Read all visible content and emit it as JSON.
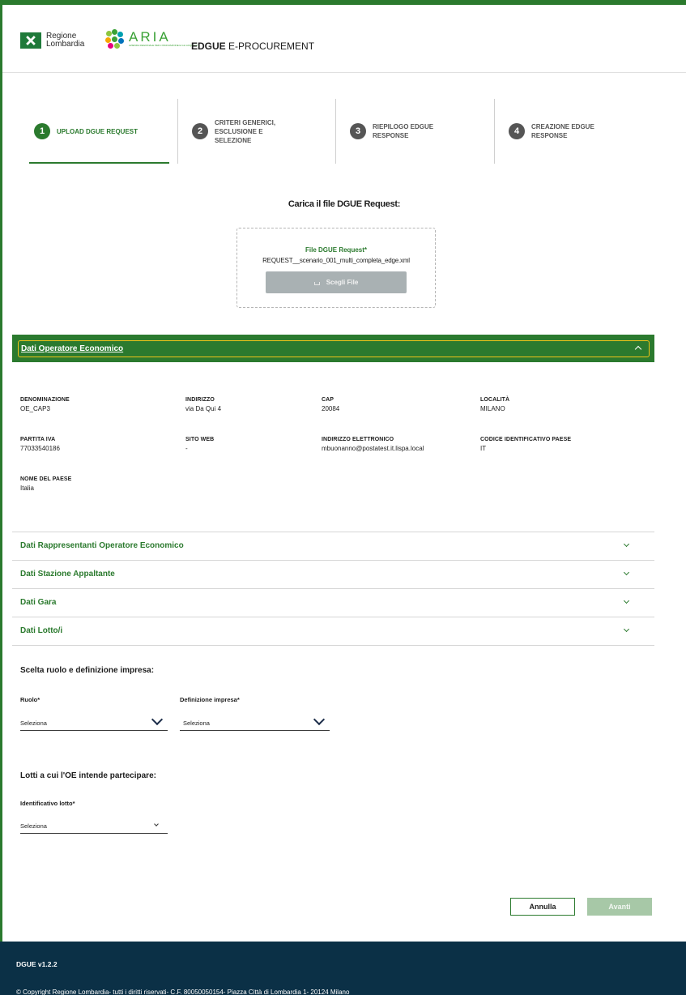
{
  "header": {
    "region_logo_line1": "Regione",
    "region_logo_line2": "Lombardia",
    "aria_logo": "ARIA",
    "aria_logo_sub": "AZIENDA REGIONALE PER L'INNOVAZIONE E GLI ACQUISTI",
    "app_title_bold": "EDGUE",
    "app_title_rest": " E-PROCUREMENT"
  },
  "stepper": [
    {
      "num": "1",
      "label": "UPLOAD DGUE REQUEST"
    },
    {
      "num": "2",
      "label": "CRITERI GENERICI, ESCLUSIONE E SELEZIONE"
    },
    {
      "num": "3",
      "label": "RIEPILOGO EDGUE RESPONSE"
    },
    {
      "num": "4",
      "label": "CREAZIONE EDGUE RESPONSE"
    }
  ],
  "upload": {
    "title": "Carica il file DGUE Request:",
    "file_label": "File DGUE Request*",
    "file_name": "REQUEST__scenario_001_multi_completa_edge.xml",
    "choose_button": "Scegli File"
  },
  "operator": {
    "title": "Dati Operatore Economico",
    "fields": [
      {
        "key": "DENOMINAZIONE",
        "value": "OE_CAP3"
      },
      {
        "key": "INDIRIZZO",
        "value": "via Da Qui 4"
      },
      {
        "key": "CAP",
        "value": "20084"
      },
      {
        "key": "LOCALITÀ",
        "value": "MILANO"
      },
      {
        "key": "PARTITA IVA",
        "value": "77033540186"
      },
      {
        "key": "SITO WEB",
        "value": "-"
      },
      {
        "key": "INDIRIZZO ELETTRONICO",
        "value": "mbuonanno@postatest.it.lispa.local"
      },
      {
        "key": "CODICE IDENTIFICATIVO PAESE",
        "value": "IT"
      },
      {
        "key": "NOME DEL PAESE",
        "value": "Italia"
      }
    ]
  },
  "accordions": [
    "Dati Rappresentanti Operatore Economico",
    "Dati Stazione Appaltante",
    "Dati Gara",
    "Dati Lotto/i"
  ],
  "role_section": {
    "title": "Scelta ruolo e definizione impresa:",
    "role_label": "Ruolo*",
    "role_value": "Seleziona",
    "company_label": "Definizione impresa*",
    "company_value": "Seleziona"
  },
  "lots_section": {
    "title": "Lotti a cui l'OE intende partecipare:",
    "lot_label": "Identificativo lotto*",
    "lot_value": "Seleziona"
  },
  "actions": {
    "cancel": "Annulla",
    "next": "Avanti"
  },
  "footer": {
    "version": "DGUE v1.2.2",
    "copyright": "© Copyright Regione Lombardia- tutti i diritti riservati- C.F. 80050050154- Piazza Città di Lombardia 1- 20124 Milano"
  },
  "colors": {
    "brand_green": "#2b7a2e",
    "footer_navy": "#0b3046",
    "focus_yellow": "#f0c419"
  }
}
